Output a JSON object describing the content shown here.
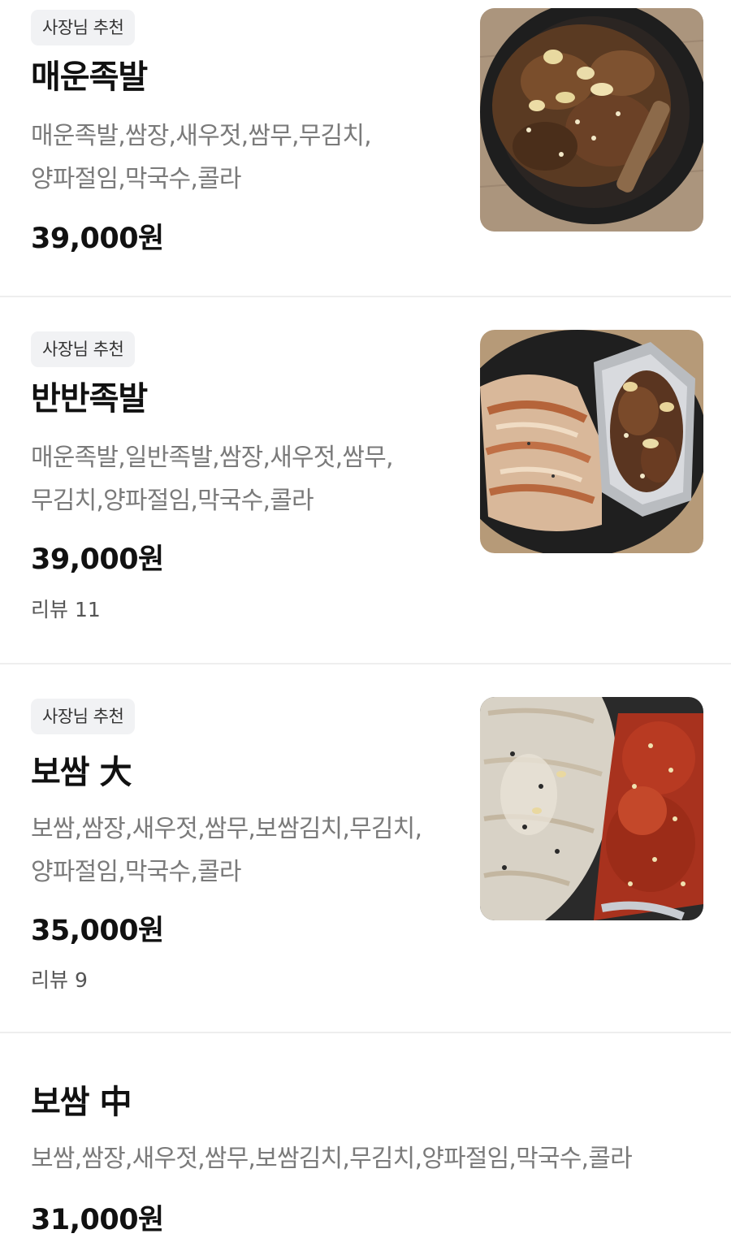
{
  "menu": {
    "items": [
      {
        "badge": "사장님 추천",
        "name": "매운족발",
        "description": "매운족발,쌈장,새우젓,쌈무,무김치,양파절임,막국수,콜라",
        "price": "39,000원",
        "image": "spicy-jokbal-photo"
      },
      {
        "badge": "사장님 추천",
        "name": "반반족발",
        "description": "매운족발,일반족발,쌈장,새우젓,쌈무,무김치,양파절임,막국수,콜라",
        "price": "39,000원",
        "review": "리뷰 11",
        "image": "half-half-jokbal-photo"
      },
      {
        "badge": "사장님 추천",
        "name": "보쌈 大",
        "description": "보쌈,쌈장,새우젓,쌈무,보쌈김치,무김치,양파절임,막국수,콜라",
        "price": "35,000원",
        "review": "리뷰 9",
        "image": "bossam-large-photo"
      },
      {
        "name": "보쌈 中",
        "description": "보쌈,쌈장,새우젓,쌈무,보쌈김치,무김치,양파절임,막국수,콜라",
        "price": "31,000원"
      }
    ]
  },
  "colors": {
    "background": "#ffffff",
    "badge_background": "#f1f2f4",
    "title": "#111111",
    "description": "#7a7a7a",
    "divider": "#eeeeee"
  }
}
